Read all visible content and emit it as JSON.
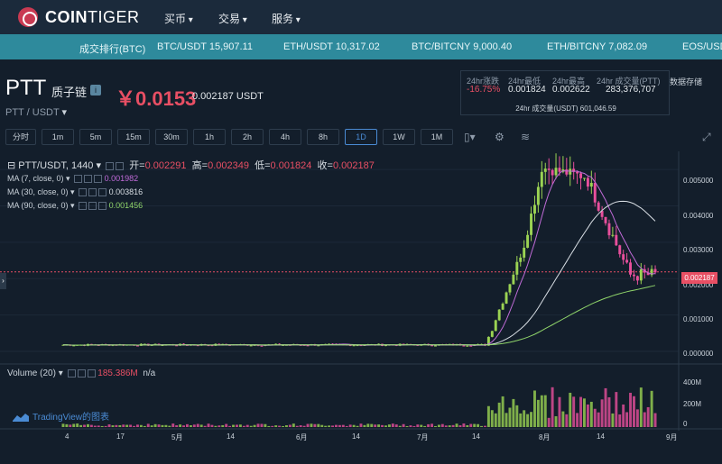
{
  "header": {
    "logo_bold": "COIN",
    "logo_rest": "TIGER",
    "nav": [
      {
        "label": "买币"
      },
      {
        "label": "交易"
      },
      {
        "label": "服务"
      }
    ]
  },
  "ticker": [
    {
      "label": "成交排行(BTC)"
    },
    {
      "label": "BTC/USDT 15,907.11"
    },
    {
      "label": "ETH/USDT 10,317.02"
    },
    {
      "label": "BTC/BITCNY 9,000.40"
    },
    {
      "label": "ETH/BITCNY 7,082.09"
    },
    {
      "label": "EOS/USDT"
    }
  ],
  "market": {
    "symbol": "PTT",
    "symbol_cn": "质子链",
    "info_icon_glyph": "i",
    "price_cny": "￥0.0153",
    "price_usdt": "0.002187 USDT",
    "pair": "PTT / USDT",
    "stats": {
      "change_label": "24hr涨跌",
      "change_value": "-16.75%",
      "low_label": "24hr最低",
      "low_value": "0.001824",
      "high_label": "24hr最高",
      "high_value": "0.002622",
      "volume_label": "24hr 成交量(PTT)",
      "volume_value": "283,376,707",
      "volume_usdt": "24hr 成交量(USDT) 601,046.59"
    },
    "data_store": "数据存储"
  },
  "intervals": [
    {
      "label": "分时",
      "active": false
    },
    {
      "label": "1m",
      "active": false
    },
    {
      "label": "5m",
      "active": false
    },
    {
      "label": "15m",
      "active": false
    },
    {
      "label": "30m",
      "active": false
    },
    {
      "label": "1h",
      "active": false
    },
    {
      "label": "2h",
      "active": false
    },
    {
      "label": "4h",
      "active": false
    },
    {
      "label": "8h",
      "active": false
    },
    {
      "label": "1D",
      "active": true
    },
    {
      "label": "1W",
      "active": false
    },
    {
      "label": "1M",
      "active": false
    }
  ],
  "chart_header": {
    "title": "PTT/USDT, 1440",
    "open_label": "开=",
    "open_value": "0.002291",
    "high_label": "高=",
    "high_value": "0.002349",
    "low_label": "低=",
    "low_value": "0.001824",
    "close_label": "收=",
    "close_value": "0.002187",
    "ma": [
      {
        "label": "MA (7, close, 0)",
        "value": "0.001982",
        "color": "#c06bd8"
      },
      {
        "label": "MA (30, close, 0)",
        "value": "0.003816",
        "color": "#d8dee4"
      },
      {
        "label": "MA (90, close, 0)",
        "value": "0.001456",
        "color": "#8fd46a"
      }
    ],
    "volume_label": "Volume (20)",
    "volume_value": "185.386M",
    "volume_na": "n/a",
    "branding": "TradingView的图表"
  },
  "colors": {
    "up": "#9bd353",
    "down": "#e84f9c",
    "accent": "#e84f64",
    "ticker_bg": "#2e8a9c"
  },
  "chart_data": {
    "type": "candlestick",
    "price_axis": [
      "0.005000",
      "0.004000",
      "0.003000",
      "0.002000",
      "0.001000",
      "0.000000"
    ],
    "last_price_tag": "0.002187",
    "volume_axis": [
      "400M",
      "200M",
      "0"
    ],
    "x_ticks": [
      "4",
      "17",
      "5月",
      "14",
      "6月",
      "14",
      "7月",
      "14",
      "8月",
      "14",
      "9月"
    ],
    "series": [
      {
        "name": "MA (7, close, 0)",
        "last": 0.001982
      },
      {
        "name": "MA (30, close, 0)",
        "last": 0.003816
      },
      {
        "name": "MA (90, close, 0)",
        "last": 0.001456
      }
    ],
    "ylim": [
      0,
      0.0053
    ]
  }
}
